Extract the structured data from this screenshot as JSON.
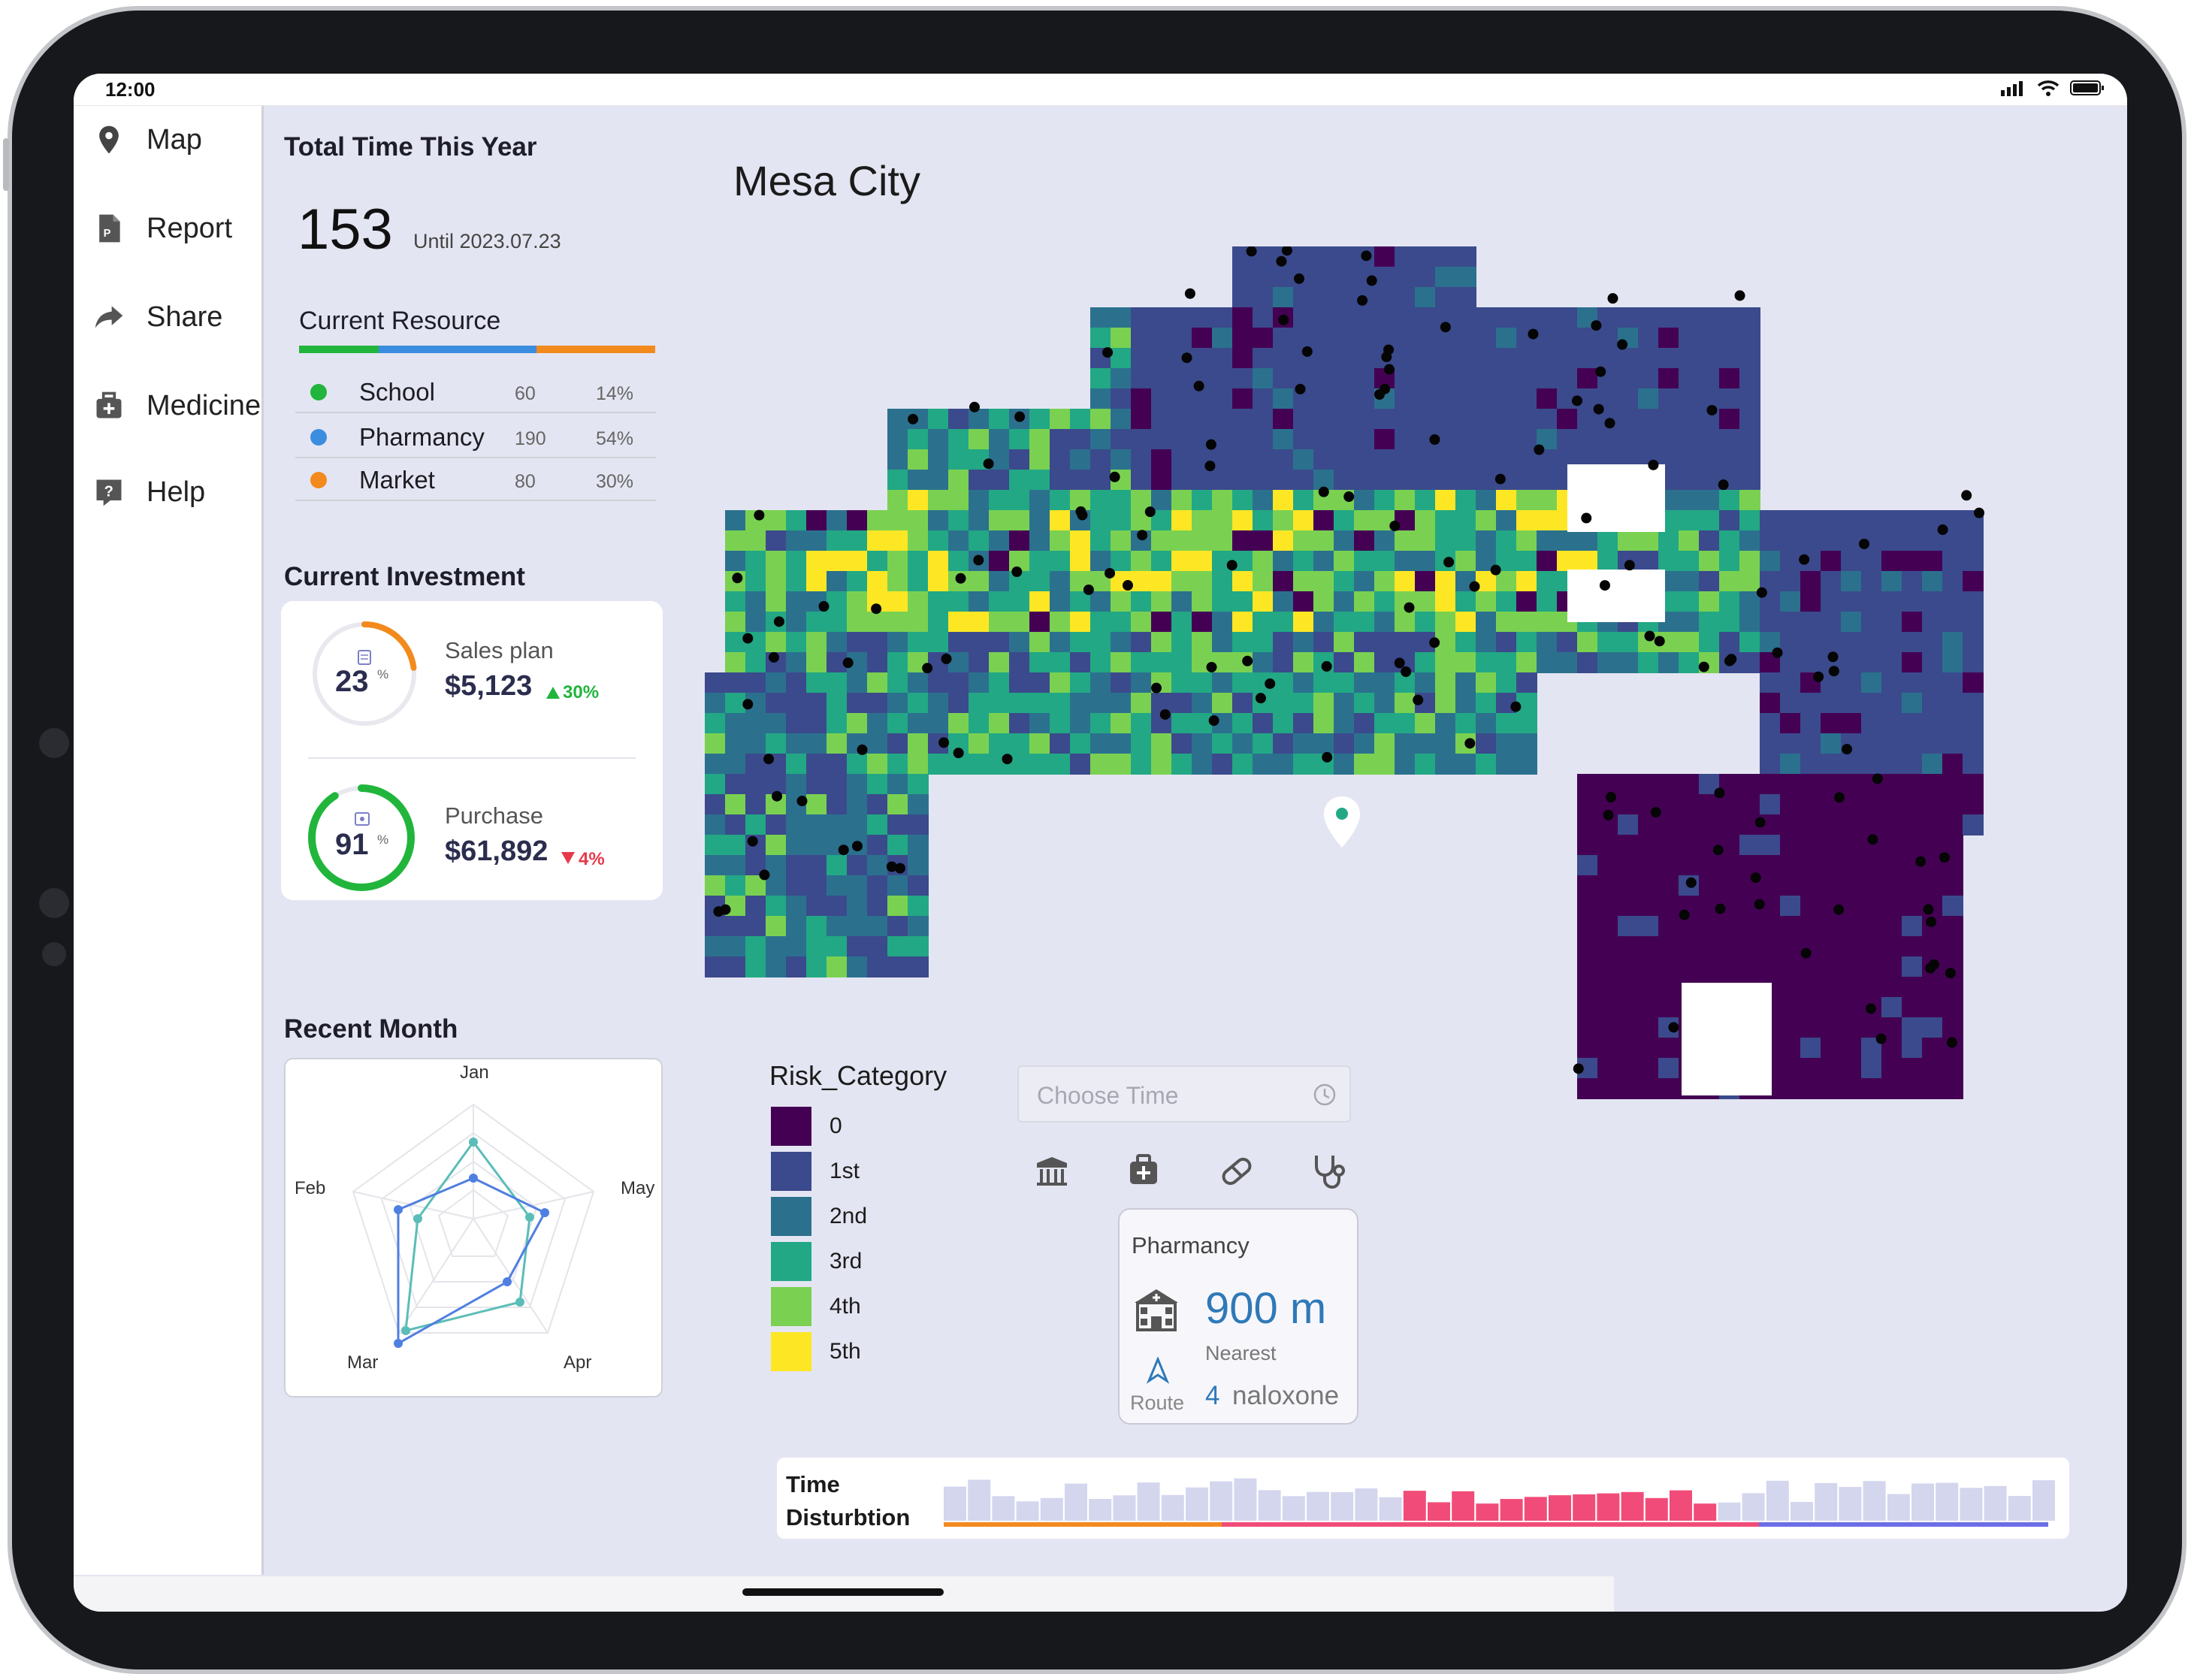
{
  "status_bar": {
    "time": "12:00"
  },
  "nav": {
    "items": [
      {
        "label": "Map",
        "icon": "map-pin-icon"
      },
      {
        "label": "Report",
        "icon": "report-icon"
      },
      {
        "label": "Share",
        "icon": "share-icon"
      },
      {
        "label": "Medicine",
        "icon": "medicine-icon"
      },
      {
        "label": "Help",
        "icon": "help-icon"
      }
    ]
  },
  "summary": {
    "title": "Total Time This Year",
    "total": "153",
    "until": "Until 2023.07.23"
  },
  "resource": {
    "title": "Current Resource",
    "rows": [
      {
        "name": "School",
        "count": "60",
        "pct": "14%",
        "color": "#21b53c"
      },
      {
        "name": "Pharmancy",
        "count": "190",
        "pct": "54%",
        "color": "#3b8de0"
      },
      {
        "name": "Market",
        "count": "80",
        "pct": "30%",
        "color": "#f28a1e"
      }
    ]
  },
  "investment": {
    "title": "Current Investment",
    "sales": {
      "label": "Sales plan",
      "value": "$5,123",
      "delta": "30%",
      "percent": "23",
      "pct_sign": "%",
      "ring": 0.23,
      "ring_color": "#f28a1e",
      "delta_color": "#21b53c"
    },
    "purchase": {
      "label": "Purchase",
      "value": "$61,892",
      "delta": "4%",
      "percent": "91",
      "pct_sign": "%",
      "ring": 0.91,
      "ring_color": "#21b53c",
      "delta_color": "#e8394a"
    }
  },
  "recent_month": {
    "title": "Recent Month",
    "axes": [
      "Jan",
      "May",
      "Apr",
      "Mar",
      "Feb"
    ]
  },
  "map": {
    "title": "Mesa City",
    "risk_colors": [
      "#440154",
      "#3b4a8c",
      "#2b718e",
      "#22a884",
      "#7ad151",
      "#fde725"
    ]
  },
  "legend": {
    "title": "Risk_Category",
    "items": [
      {
        "label": "0",
        "color": "#440154"
      },
      {
        "label": "1st",
        "color": "#3b4a8c"
      },
      {
        "label": "2nd",
        "color": "#2b718e"
      },
      {
        "label": "3rd",
        "color": "#22a884"
      },
      {
        "label": "4th",
        "color": "#7ad151"
      },
      {
        "label": "5th",
        "color": "#fde725"
      }
    ]
  },
  "time_picker": {
    "placeholder": "Choose Time"
  },
  "categories": [
    "bank-icon",
    "medicine-kit-icon",
    "pill-icon",
    "stethoscope-icon"
  ],
  "pharmacy_card": {
    "title": "Pharmancy",
    "distance": "900 m",
    "nearest": "Nearest",
    "route": "Route",
    "count": "4",
    "item": "naloxone"
  },
  "time_distribution": {
    "label_line1": "Time",
    "label_line2": "Disturbtion"
  }
}
